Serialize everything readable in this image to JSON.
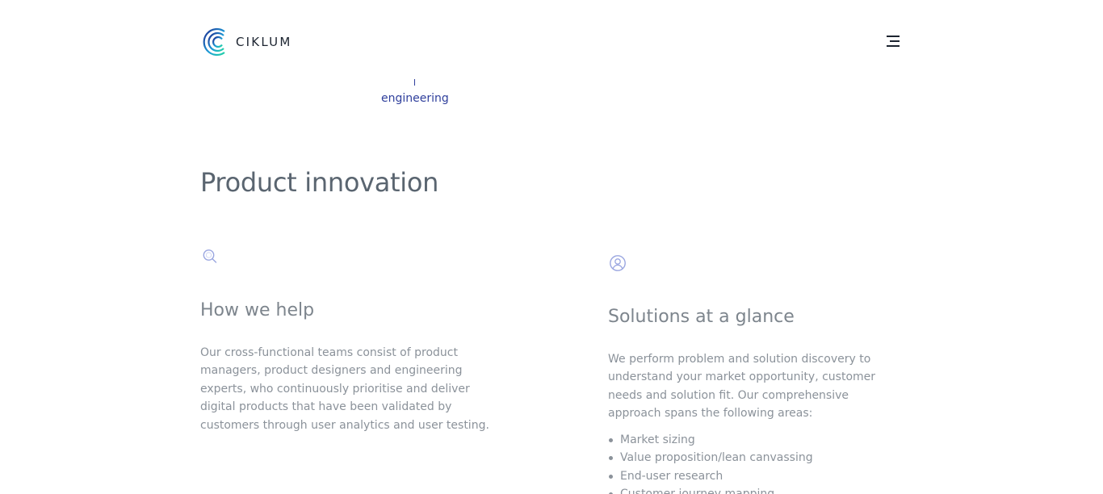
{
  "header": {
    "logo_text": "CIKLUM",
    "brand_colors": {
      "gradient_start": "#1f2b8f",
      "gradient_mid": "#1d9bd8",
      "gradient_end": "#22d3a6"
    },
    "menu_icon": "hamburger-icon"
  },
  "tabs": {
    "active_label": "engineering",
    "link_color": "#2f3f9c"
  },
  "section": {
    "title": "Product innovation"
  },
  "columns": {
    "left": {
      "icon": "search-icon",
      "title": "How we help",
      "text": "Our cross-functional teams consist of product managers, product designers and engineering experts, who continuously prioritise and deliver digital products that have been validated by customers through user analytics and user testing."
    },
    "right": {
      "icon": "user-icon",
      "title": "Solutions at a glance",
      "text": "We perform problem and solution discovery to understand your market opportunity, customer needs and solution fit. Our comprehensive approach spans the following areas:",
      "items": [
        "Market sizing",
        "Value proposition/lean canvassing",
        "End-user research",
        "Customer journey mapping"
      ]
    }
  }
}
